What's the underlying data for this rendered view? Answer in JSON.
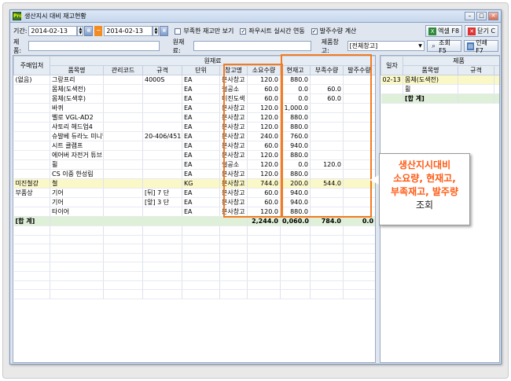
{
  "window": {
    "title": "생산지시 대비 재고현황",
    "app_icon": "Pro"
  },
  "toolbar1": {
    "period_label": "기간:",
    "date_from": "2014-02-13",
    "date_to": "2014-02-13",
    "tilde": "~",
    "checks": [
      {
        "label": "부족한 재고만 보기",
        "checked": false
      },
      {
        "label": "좌우시트 실시간 연동",
        "checked": true
      },
      {
        "label": "발주수량 계산",
        "checked": true
      }
    ],
    "excel_label": "엑셀 F8",
    "close_label": "닫기 C"
  },
  "toolbar2": {
    "product_label": "제품:",
    "product_value": "",
    "material_label": "원재료:",
    "material_value": "",
    "warehouse_label": "제품창고:",
    "warehouse_value": "[전체창고]",
    "search_label": "조회 F5",
    "print_label": "인쇄 F7"
  },
  "left_table": {
    "group_header": "원재료",
    "headers": [
      "주매입처",
      "품목명",
      "관리코드",
      "규격",
      "단위",
      "창고명",
      "소요수량",
      "현재고",
      "부족수량",
      "발주수량"
    ],
    "rows": [
      {
        "vendor": "(없음)",
        "item": "그랑프리",
        "code": "",
        "spec": "4000S",
        "unit": "EA",
        "wh": "본사창고",
        "req": "120.0",
        "stock": "880.0",
        "short": "",
        "order": ""
      },
      {
        "vendor": "",
        "item": "몸체(도색전)",
        "code": "",
        "spec": "",
        "unit": "EA",
        "wh": "철공소",
        "req": "60.0",
        "stock": "0.0",
        "short": "60.0",
        "order": ""
      },
      {
        "vendor": "",
        "item": "몸체(도색후)",
        "code": "",
        "spec": "",
        "unit": "EA",
        "wh": "미진도색",
        "req": "60.0",
        "stock": "0.0",
        "short": "60.0",
        "order": ""
      },
      {
        "vendor": "",
        "item": "바퀴",
        "code": "",
        "spec": "",
        "unit": "EA",
        "wh": "본사창고",
        "req": "120.0",
        "stock": "1,000.0",
        "short": "",
        "order": ""
      },
      {
        "vendor": "",
        "item": "벨로 VGL-AD2",
        "code": "",
        "spec": "",
        "unit": "EA",
        "wh": "본사창고",
        "req": "120.0",
        "stock": "880.0",
        "short": "",
        "order": ""
      },
      {
        "vendor": "",
        "item": "샤토리 헤드업4",
        "code": "",
        "spec": "",
        "unit": "EA",
        "wh": "본사창고",
        "req": "120.0",
        "stock": "880.0",
        "short": "",
        "order": ""
      },
      {
        "vendor": "",
        "item": "슈발베 듀라노 미니벨",
        "code": "",
        "spec": "20-406/451",
        "unit": "EA",
        "wh": "본사창고",
        "req": "240.0",
        "stock": "760.0",
        "short": "",
        "order": ""
      },
      {
        "vendor": "",
        "item": "시트 클램프",
        "code": "",
        "spec": "",
        "unit": "EA",
        "wh": "본사창고",
        "req": "60.0",
        "stock": "940.0",
        "short": "",
        "order": ""
      },
      {
        "vendor": "",
        "item": "에어버 자전거 튜브",
        "code": "",
        "spec": "",
        "unit": "EA",
        "wh": "본사창고",
        "req": "120.0",
        "stock": "880.0",
        "short": "",
        "order": ""
      },
      {
        "vendor": "",
        "item": "휠",
        "code": "",
        "spec": "",
        "unit": "EA",
        "wh": "철공소",
        "req": "120.0",
        "stock": "0.0",
        "short": "120.0",
        "order": ""
      },
      {
        "vendor": "",
        "item": "CS 이중 한성림",
        "code": "",
        "spec": "",
        "unit": "EA",
        "wh": "본사창고",
        "req": "120.0",
        "stock": "880.0",
        "short": "",
        "order": ""
      },
      {
        "vendor": "미진철강",
        "item": "철",
        "code": "",
        "spec": "",
        "unit": "KG",
        "wh": "본사창고",
        "req": "744.0",
        "stock": "200.0",
        "short": "544.0",
        "order": "",
        "highlight": true
      },
      {
        "vendor": "부품상",
        "item": "기어",
        "code": "",
        "spec": "[뒤] 7 단",
        "unit": "EA",
        "wh": "본사창고",
        "req": "60.0",
        "stock": "940.0",
        "short": "",
        "order": ""
      },
      {
        "vendor": "",
        "item": "기어",
        "code": "",
        "spec": "[앞] 3 단",
        "unit": "EA",
        "wh": "본사창고",
        "req": "60.0",
        "stock": "940.0",
        "short": "",
        "order": ""
      },
      {
        "vendor": "",
        "item": "타이어",
        "code": "",
        "spec": "",
        "unit": "EA",
        "wh": "본사창고",
        "req": "120.0",
        "stock": "880.0",
        "short": "",
        "order": ""
      }
    ],
    "total": {
      "label": "[합 계]",
      "req": "2,244.0",
      "stock": "0,060.0",
      "short": "784.0",
      "order": "0.0"
    }
  },
  "right_table": {
    "group_header": "제품",
    "headers": [
      "일자",
      "품목명",
      "규격",
      "생"
    ],
    "rows": [
      {
        "date": "02-13",
        "item": "몸체(도색전)",
        "highlight": true
      },
      {
        "date": "",
        "item": "휠",
        "highlight": false
      }
    ],
    "total_label": "[합 계]"
  },
  "callout": {
    "lines": [
      "생산지시대비",
      "소요량, 현재고,",
      "부족재고, 발주량"
    ],
    "last": "조회"
  }
}
